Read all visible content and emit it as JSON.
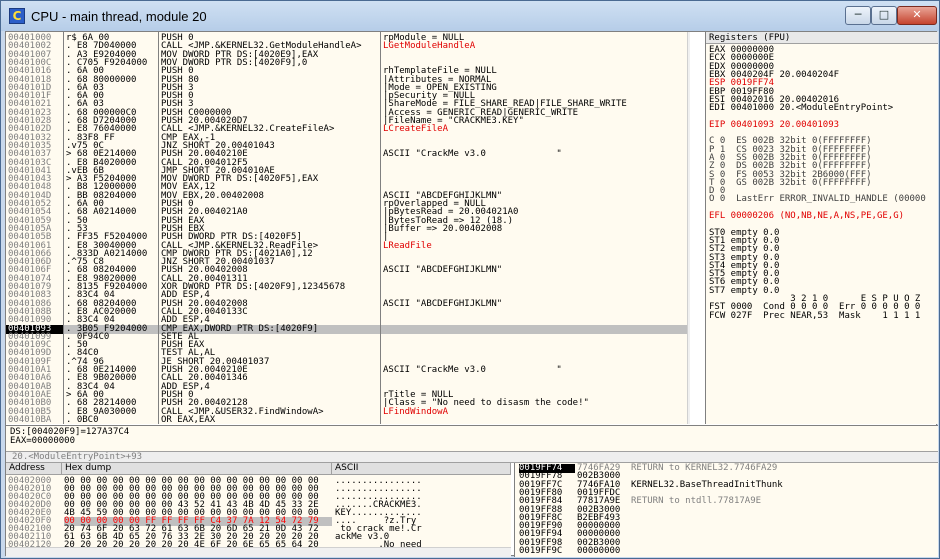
{
  "window": {
    "title": "CPU - main thread, module 20",
    "icon_letter": "C",
    "min_label": "─",
    "max_label": "□",
    "close_label": "✕"
  },
  "cpu": {
    "rows": [
      {
        "a": "00401000",
        "h": "r$ 6A 00",
        "d": "PUSH 0",
        "c": "rpModule = NULL"
      },
      {
        "a": "00401002",
        "h": ". E8 7D040000",
        "d": "CALL <JMP.&KERNEL32.GetModuleHandleA>",
        "c": "LGetModuleHandleA"
      },
      {
        "a": "00401007",
        "h": ". A3 E9204000",
        "d": "MOV DWORD PTR DS:[4020E9],EAX",
        "c": ""
      },
      {
        "a": "0040100C",
        "h": ". C705 F9204000",
        "d": "MOV DWORD PTR DS:[4020F9],0",
        "c": ""
      },
      {
        "a": "00401016",
        "h": ". 6A 00",
        "d": "PUSH 0",
        "c": "rhTemplateFile = NULL"
      },
      {
        "a": "00401018",
        "h": ". 68 80000000",
        "d": "PUSH 80",
        "c": "|Attributes = NORMAL"
      },
      {
        "a": "0040101D",
        "h": ". 6A 03",
        "d": "PUSH 3",
        "c": "|Mode = OPEN_EXISTING"
      },
      {
        "a": "0040101F",
        "h": ". 6A 00",
        "d": "PUSH 0",
        "c": "|pSecurity = NULL"
      },
      {
        "a": "00401021",
        "h": ". 6A 03",
        "d": "PUSH 3",
        "c": "|ShareMode = FILE_SHARE_READ|FILE_SHARE_WRITE"
      },
      {
        "a": "00401023",
        "h": ". 68 000000C0",
        "d": "PUSH C0000000",
        "c": "|Access = GENERIC_READ|GENERIC_WRITE"
      },
      {
        "a": "00401028",
        "h": ". 68 D7204000",
        "d": "PUSH 20.004020D7",
        "c": "|FileName = \"CRACKME3.KEY\""
      },
      {
        "a": "0040102D",
        "h": ". E8 76040000",
        "d": "CALL <JMP.&KERNEL32.CreateFileA>",
        "c": "LCreateFileA"
      },
      {
        "a": "00401032",
        "h": ". 83F8 FF",
        "d": "CMP EAX,-1",
        "c": ""
      },
      {
        "a": "00401035",
        "h": ".v75 0C",
        "d": "JNZ SHORT 20.00401043",
        "c": ""
      },
      {
        "a": "00401037",
        "h": "> 68 0E214000",
        "d": "PUSH 20.0040210E",
        "c": "ASCII \"CrackMe v3.0             \""
      },
      {
        "a": "0040103C",
        "h": ". E8 B4020000",
        "d": "CALL 20.004012F5",
        "c": ""
      },
      {
        "a": "00401041",
        "h": ".vEB 6B",
        "d": "JMP SHORT 20.004010AE",
        "c": ""
      },
      {
        "a": "00401043",
        "h": "> A3 F5204000",
        "d": "MOV DWORD PTR DS:[4020F5],EAX",
        "c": ""
      },
      {
        "a": "00401048",
        "h": ". B8 12000000",
        "d": "MOV EAX,12",
        "c": ""
      },
      {
        "a": "0040104D",
        "h": ". BB 08204000",
        "d": "MOV EBX,20.00402008",
        "c": "ASCII \"ABCDEFGHIJKLMN\""
      },
      {
        "a": "00401052",
        "h": ". 6A 00",
        "d": "PUSH 0",
        "c": "rpOverlapped = NULL"
      },
      {
        "a": "00401054",
        "h": ". 68 A0214000",
        "d": "PUSH 20.004021A0",
        "c": "|pBytesRead = 20.004021A0"
      },
      {
        "a": "00401059",
        "h": ". 50",
        "d": "PUSH EAX",
        "c": "|BytesToRead => 12 (18.)"
      },
      {
        "a": "0040105A",
        "h": ". 53",
        "d": "PUSH EBX",
        "c": "|Buffer => 20.00402008"
      },
      {
        "a": "0040105B",
        "h": ". FF35 F5204000",
        "d": "PUSH DWORD PTR DS:[4020F5]",
        "c": "|"
      },
      {
        "a": "00401061",
        "h": ". E8 30040000",
        "d": "CALL <JMP.&KERNEL32.ReadFile>",
        "c": "LReadFile"
      },
      {
        "a": "00401066",
        "h": ". 833D A0214000",
        "d": "CMP DWORD PTR DS:[4021A0],12",
        "c": ""
      },
      {
        "a": "0040106D",
        "h": ".^75 C8",
        "d": "JNZ SHORT 20.00401037",
        "c": ""
      },
      {
        "a": "0040106F",
        "h": ". 68 08204000",
        "d": "PUSH 20.00402008",
        "c": "ASCII \"ABCDEFGHIJKLMN\""
      },
      {
        "a": "00401074",
        "h": ". E8 98020000",
        "d": "CALL 20.00401311",
        "c": ""
      },
      {
        "a": "00401079",
        "h": ". 8135 F9204000",
        "d": "XOR DWORD PTR DS:[4020F9],12345678",
        "c": ""
      },
      {
        "a": "00401083",
        "h": ". 83C4 04",
        "d": "ADD ESP,4",
        "c": ""
      },
      {
        "a": "00401086",
        "h": ". 68 08204000",
        "d": "PUSH 20.00402008",
        "c": "ASCII \"ABCDEFGHIJKLMN\""
      },
      {
        "a": "0040108B",
        "h": ". E8 AC020000",
        "d": "CALL 20.0040133C",
        "c": ""
      },
      {
        "a": "00401090",
        "h": ". 83C4 04",
        "d": "ADD ESP,4",
        "c": ""
      },
      {
        "a": "00401093",
        "h": ". 3B05 F9204000",
        "d": "CMP EAX,DWORD PTR DS:[4020F9]",
        "c": ""
      },
      {
        "a": "00401099",
        "h": ". 0F94C0",
        "d": "SETE AL",
        "c": ""
      },
      {
        "a": "0040109C",
        "h": ". 50",
        "d": "PUSH EAX",
        "c": ""
      },
      {
        "a": "0040109D",
        "h": ". 84C0",
        "d": "TEST AL,AL",
        "c": ""
      },
      {
        "a": "0040109F",
        "h": ".^74 96",
        "d": "JE SHORT 20.00401037",
        "c": ""
      },
      {
        "a": "004010A1",
        "h": ". 68 0E214000",
        "d": "PUSH 20.0040210E",
        "c": "ASCII \"CrackMe v3.0             \""
      },
      {
        "a": "004010A6",
        "h": ". E8 9B020000",
        "d": "CALL 20.00401346",
        "c": ""
      },
      {
        "a": "004010AB",
        "h": ". 83C4 04",
        "d": "ADD ESP,4",
        "c": ""
      },
      {
        "a": "004010AE",
        "h": "> 6A 00",
        "d": "PUSH 0",
        "c": "rTitle = NULL"
      },
      {
        "a": "004010B0",
        "h": ". 68 28214000",
        "d": "PUSH 20.00402128",
        "c": "|Class = \"No need to disasm the code!\""
      },
      {
        "a": "004010B5",
        "h": ". E8 9A030000",
        "d": "CALL <JMP.&USER32.FindWindowA>",
        "c": "LFindWindowA"
      },
      {
        "a": "004010BA",
        "h": ". 0BC0",
        "d": "OR EAX,EAX",
        "c": ""
      }
    ],
    "selected_index": 35,
    "red_comments": [
      1,
      11,
      25,
      45
    ]
  },
  "registers": {
    "header": "Registers (FPU)",
    "lines": [
      "EAX 00000000",
      "ECX 0000000E",
      "EDX 00000000",
      "EBX 0040204F 20.0040204F",
      "ESP 0019FF74",
      "EBP 0019FF80",
      "ESI 00402016 20.00402016",
      "EDI 00401000 20.<ModuleEntryPoint>",
      "",
      "EIP 00401093 20.00401093",
      "",
      "C 0  ES 002B 32bit 0(FFFFFFFF)",
      "P 1  CS 0023 32bit 0(FFFFFFFF)",
      "A 0  SS 002B 32bit 0(FFFFFFFF)",
      "Z 0  DS 002B 32bit 0(FFFFFFFF)",
      "S 0  FS 0053 32bit 2B6000(FFF)",
      "T 0  GS 002B 32bit 0(FFFFFFFF)",
      "D 0",
      "O 0  LastErr ERROR_INVALID_HANDLE (00000",
      "",
      "EFL 00000206 (NO,NB,NE,A,NS,PE,GE,G)",
      "",
      "ST0 empty 0.0",
      "ST1 empty 0.0",
      "ST2 empty 0.0",
      "ST3 empty 0.0",
      "ST4 empty 0.0",
      "ST5 empty 0.0",
      "ST6 empty 0.0",
      "ST7 empty 0.0",
      "               3 2 1 0      E S P U O Z",
      "FST 0000  Cond 0 0 0 0  Err 0 0 0 0 0 0",
      "FCW 027F  Prec NEAR,53  Mask    1 1 1 1"
    ]
  },
  "info": {
    "line1": "DS:[004020F9]=127A37C4",
    "line2": "EAX=00000000"
  },
  "status": "20.<ModuleEntryPoint>+93",
  "dump": {
    "headers": [
      "Address",
      "Hex dump",
      "ASCII"
    ],
    "rows": [
      {
        "a": "00402000",
        "h": "00 00 00 00 00 00 00 00 00 00 00 00 00 00 00 00",
        "s": "................"
      },
      {
        "a": "00402010",
        "h": "00 00 00 00 00 00 00 00 00 00 00 00 00 00 00 00",
        "s": "................"
      },
      {
        "a": "004020C0",
        "h": "00 00 00 00 00 00 00 00 00 00 00 00 00 00 00 00",
        "s": "................"
      },
      {
        "a": "004020D0",
        "h": "00 00 00 00 00 00 00 43 52 41 43 4B 4D 45 33 2E",
        "s": ".......CRACKME3."
      },
      {
        "a": "004020E0",
        "h": "4B 45 59 00 00 00 00 00 00 00 00 00 00 00 00 00",
        "s": "KEY............."
      },
      {
        "a": "004020F0",
        "h": "00 00 00 00 00 FF FF FF FF C4 37 7A 12 54 72 79",
        "s": "....     ?z.Try"
      },
      {
        "a": "00402100",
        "h": "20 74 6F 20 63 72 61 63 6B 20 6D 65 21 0D 43 72",
        "s": " to crack me!.Cr"
      },
      {
        "a": "00402110",
        "h": "61 63 6B 4D 65 20 76 33 2E 30 20 20 20 20 20 20",
        "s": "ackMe v3.0      "
      },
      {
        "a": "00402120",
        "h": "20 20 20 20 20 20 20 20 4E 6F 20 6E 65 65 64 20",
        "s": "        .No need"
      }
    ]
  },
  "stack": {
    "rows": [
      {
        "a": "0019FF74",
        "v": "7746FA29",
        "c": "RETURN to KERNEL32.7746FA29"
      },
      {
        "a": "0019FF78",
        "v": "002B3000",
        "c": ""
      },
      {
        "a": "0019FF7C",
        "v": "7746FA10",
        "c": "KERNEL32.BaseThreadInitThunk"
      },
      {
        "a": "0019FF80",
        "v": "0019FFDC",
        "c": ""
      },
      {
        "a": "0019FF84",
        "v": "77817A9E",
        "c": "RETURN to ntdll.77817A9E"
      },
      {
        "a": "0019FF88",
        "v": "002B3000",
        "c": ""
      },
      {
        "a": "0019FF8C",
        "v": "B2EBF493",
        "c": ""
      },
      {
        "a": "0019FF90",
        "v": "00000000",
        "c": ""
      },
      {
        "a": "0019FF94",
        "v": "00000000",
        "c": ""
      },
      {
        "a": "0019FF98",
        "v": "002B3000",
        "c": ""
      },
      {
        "a": "0019FF9C",
        "v": "00000000",
        "c": ""
      }
    ]
  }
}
